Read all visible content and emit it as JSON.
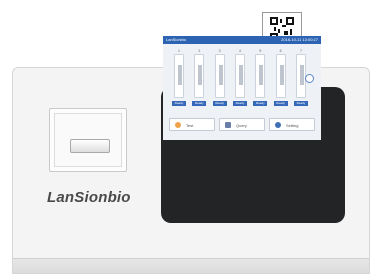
{
  "brand": {
    "logo_text": "LanSionbio"
  },
  "display": {
    "status_left": "LanSionbio",
    "status_right": "2016-10-11 13:00:27",
    "channels": [
      {
        "label": "1",
        "status": "Ready"
      },
      {
        "label": "2",
        "status": "Ready"
      },
      {
        "label": "3",
        "status": "Ready"
      },
      {
        "label": "4",
        "status": "Ready"
      },
      {
        "label": "5",
        "status": "Ready"
      },
      {
        "label": "6",
        "status": "Ready"
      },
      {
        "label": "7",
        "status": "Ready"
      }
    ],
    "buttons": [
      {
        "label": "Test",
        "icon": "search-icon",
        "color": "#f0a24a"
      },
      {
        "label": "Query",
        "icon": "document-icon",
        "color": "#6a7fa8"
      },
      {
        "label": "Setting",
        "icon": "gear-icon",
        "color": "#3f6fb5"
      }
    ]
  },
  "colors": {
    "accent": "#2c64b3",
    "screen_bezel": "#222426"
  }
}
